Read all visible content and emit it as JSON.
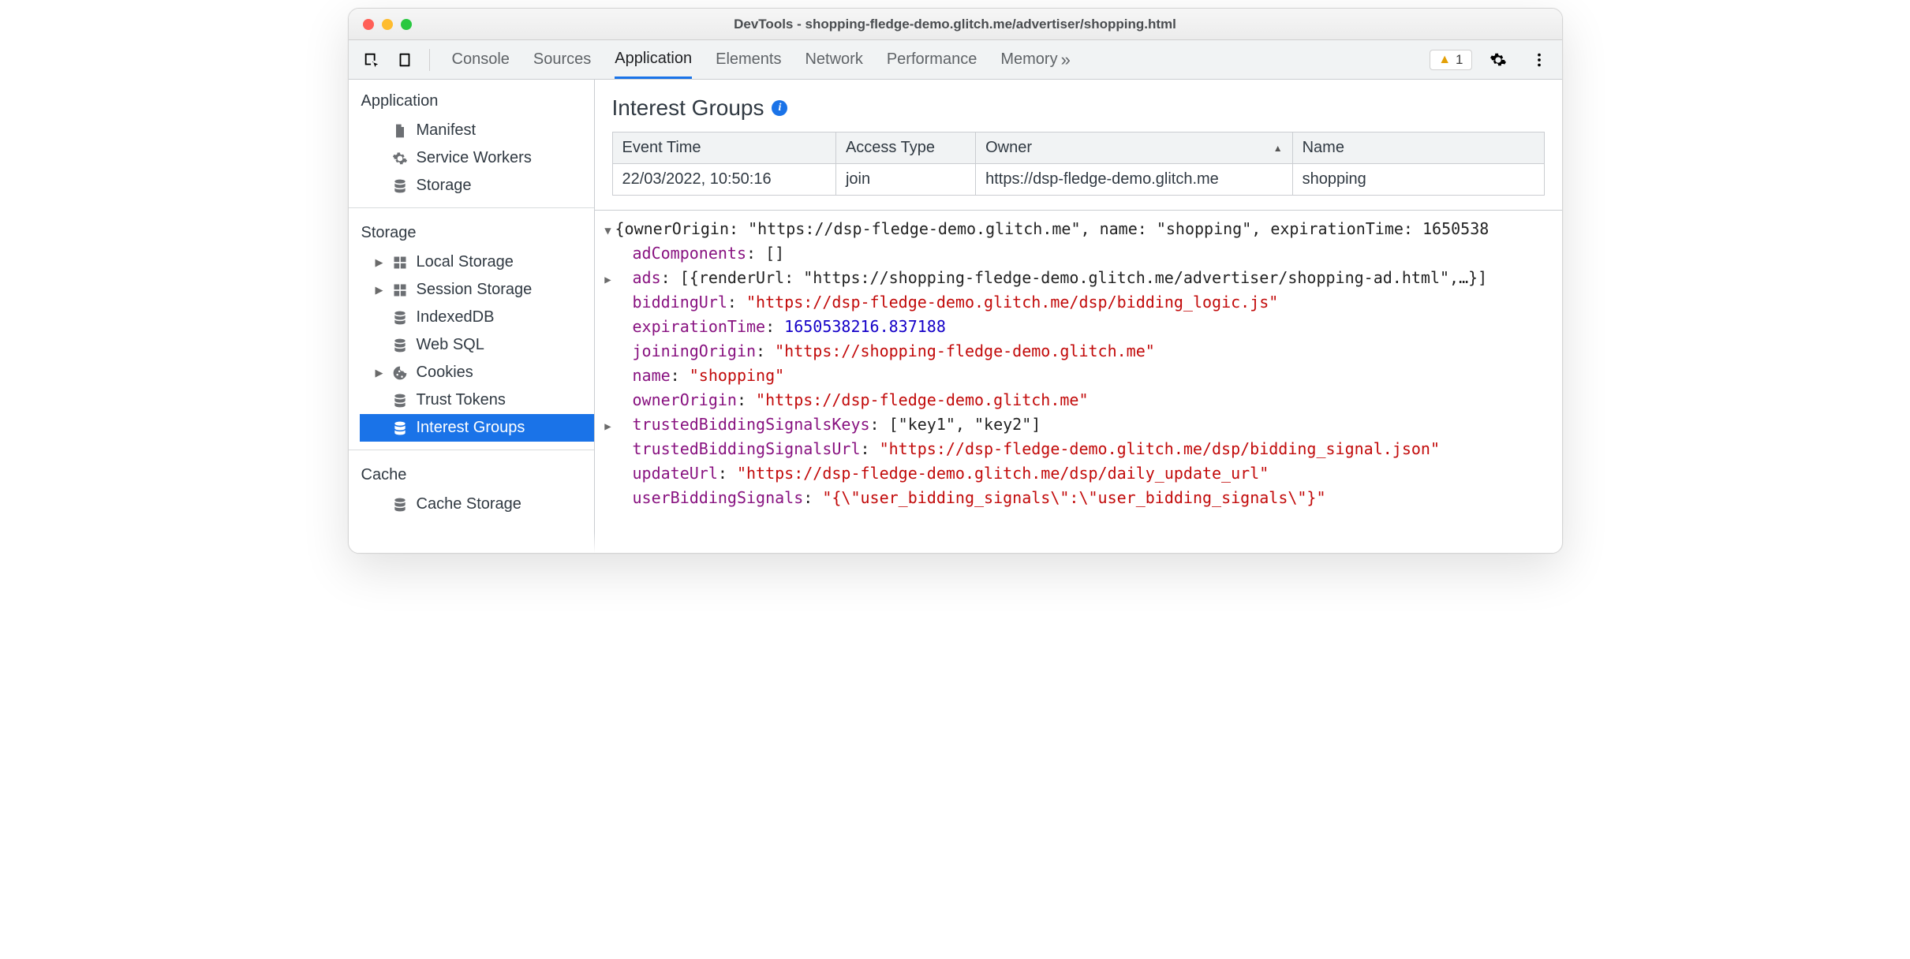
{
  "window": {
    "title": "DevTools - shopping-fledge-demo.glitch.me/advertiser/shopping.html"
  },
  "toolbar": {
    "tabs": [
      "Console",
      "Sources",
      "Application",
      "Elements",
      "Network",
      "Performance",
      "Memory"
    ],
    "active_tab": "Application",
    "more_glyph": "»",
    "warnings_count": "1"
  },
  "sidebar": {
    "sections": [
      {
        "heading": "Application",
        "items": [
          {
            "label": "Manifest",
            "icon": "file",
            "expandable": false
          },
          {
            "label": "Service Workers",
            "icon": "gear",
            "expandable": false
          },
          {
            "label": "Storage",
            "icon": "db",
            "expandable": false
          }
        ]
      },
      {
        "heading": "Storage",
        "items": [
          {
            "label": "Local Storage",
            "icon": "grid",
            "expandable": true
          },
          {
            "label": "Session Storage",
            "icon": "grid",
            "expandable": true
          },
          {
            "label": "IndexedDB",
            "icon": "db",
            "expandable": false
          },
          {
            "label": "Web SQL",
            "icon": "db",
            "expandable": false
          },
          {
            "label": "Cookies",
            "icon": "cookie",
            "expandable": true
          },
          {
            "label": "Trust Tokens",
            "icon": "db",
            "expandable": false
          },
          {
            "label": "Interest Groups",
            "icon": "db",
            "expandable": false,
            "selected": true
          }
        ]
      },
      {
        "heading": "Cache",
        "items": [
          {
            "label": "Cache Storage",
            "icon": "db",
            "expandable": false
          }
        ]
      }
    ]
  },
  "panel": {
    "title": "Interest Groups",
    "table": {
      "columns": [
        "Event Time",
        "Access Type",
        "Owner",
        "Name"
      ],
      "sorted_column_index": 2,
      "rows": [
        [
          "22/03/2022, 10:50:16",
          "join",
          "https://dsp-fledge-demo.glitch.me",
          "shopping"
        ]
      ]
    },
    "details": {
      "top_summary": "{ownerOrigin: \"https://dsp-fledge-demo.glitch.me\", name: \"shopping\", expirationTime: 1650538",
      "fields": [
        {
          "key": "adComponents",
          "kind": "plain",
          "value": "[]"
        },
        {
          "key": "ads",
          "kind": "plain",
          "expandable": true,
          "value": "[{renderUrl: \"https://shopping-fledge-demo.glitch.me/advertiser/shopping-ad.html\",…}]"
        },
        {
          "key": "biddingUrl",
          "kind": "str",
          "value": "\"https://dsp-fledge-demo.glitch.me/dsp/bidding_logic.js\""
        },
        {
          "key": "expirationTime",
          "kind": "num",
          "value": "1650538216.837188"
        },
        {
          "key": "joiningOrigin",
          "kind": "str",
          "value": "\"https://shopping-fledge-demo.glitch.me\""
        },
        {
          "key": "name",
          "kind": "str",
          "value": "\"shopping\""
        },
        {
          "key": "ownerOrigin",
          "kind": "str",
          "value": "\"https://dsp-fledge-demo.glitch.me\""
        },
        {
          "key": "trustedBiddingSignalsKeys",
          "kind": "plain",
          "expandable": true,
          "value": "[\"key1\", \"key2\"]"
        },
        {
          "key": "trustedBiddingSignalsUrl",
          "kind": "str",
          "value": "\"https://dsp-fledge-demo.glitch.me/dsp/bidding_signal.json\""
        },
        {
          "key": "updateUrl",
          "kind": "str",
          "value": "\"https://dsp-fledge-demo.glitch.me/dsp/daily_update_url\""
        },
        {
          "key": "userBiddingSignals",
          "kind": "str",
          "value": "\"{\\\"user_bidding_signals\\\":\\\"user_bidding_signals\\\"}\""
        }
      ]
    }
  }
}
